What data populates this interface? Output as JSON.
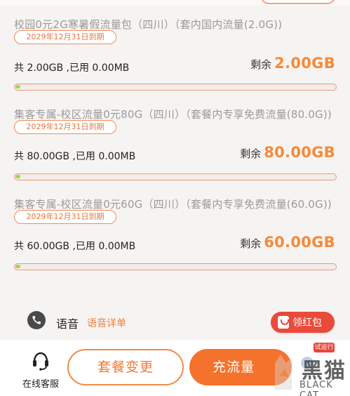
{
  "plans": [
    {
      "title": "校园0元2G寒暑假流量包（四川）（套内国内流量(2.0G))",
      "expiry": "2029年12月31日到期",
      "usage": "共 2.00GB ,已用 0.00MB",
      "remain_label": "剩余",
      "remain_value": "2.00GB",
      "used_fraction": 0
    },
    {
      "title": "集客专属-校区流量0元80G（四川）（套餐内专享免费流量(80.0G))",
      "expiry": "2029年12月31日到期",
      "usage": "共 80.00GB ,已用 0.00MB",
      "remain_label": "剩余",
      "remain_value": "80.00GB",
      "used_fraction": 0
    },
    {
      "title": "集客专属-校区流量0元60G（四川）（套餐内专享免费流量(60.0G))",
      "expiry": "2029年12月31日到期",
      "usage": "共 60.00GB ,已用 0.00MB",
      "remain_label": "剩余",
      "remain_value": "60.00GB",
      "used_fraction": 0
    }
  ],
  "voice": {
    "label": "语音",
    "detail_link": "语音详单",
    "icon": "phone-icon"
  },
  "red_packet": {
    "label": "领红包",
    "icon": "red-packet-icon"
  },
  "bottom_bar": {
    "customer_service": "在线客服",
    "plan_change": "套餐变更",
    "recharge": "充流量",
    "trial_badge": "试运行"
  },
  "watermark": {
    "cn": "黑猫",
    "en": "BLACK CAT"
  },
  "colors": {
    "accent": "#f4722b",
    "remain_value": "#f58a3a",
    "progress_fill": "#a8d34d",
    "red_packet": "#e94a3a"
  }
}
